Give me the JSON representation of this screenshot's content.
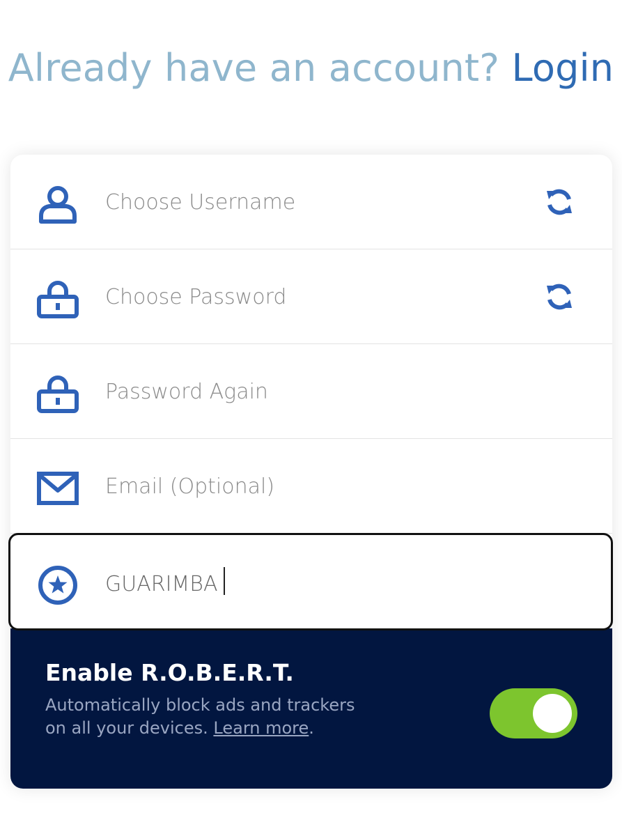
{
  "header": {
    "question": "Already have an account?",
    "login_link": "Login"
  },
  "form": {
    "username": {
      "placeholder": "Choose Username",
      "value": ""
    },
    "password": {
      "placeholder": "Choose Password",
      "value": ""
    },
    "password_again": {
      "placeholder": "Password Again",
      "value": ""
    },
    "email": {
      "placeholder": "Email (Optional)",
      "value": ""
    },
    "promo_code": {
      "placeholder": "",
      "value": "GUARIMBA"
    }
  },
  "robert": {
    "title": "Enable R.O.B.E.R.T.",
    "description": "Automatically block ads and trackers on all your devices.",
    "learn_more": "Learn more",
    "trailing_period": ".",
    "enabled": true
  },
  "colors": {
    "icon_blue": "#2f62b8",
    "link_blue": "#2f6bb3",
    "header_light": "#8fb6cd",
    "robert_bg": "#021640",
    "toggle_on": "#7dc52e"
  },
  "icons": {
    "username": "user-icon",
    "password": "lock-icon",
    "password_again": "lock-icon",
    "email": "envelope-icon",
    "promo": "star-circle-icon",
    "refresh": "refresh-icon"
  }
}
